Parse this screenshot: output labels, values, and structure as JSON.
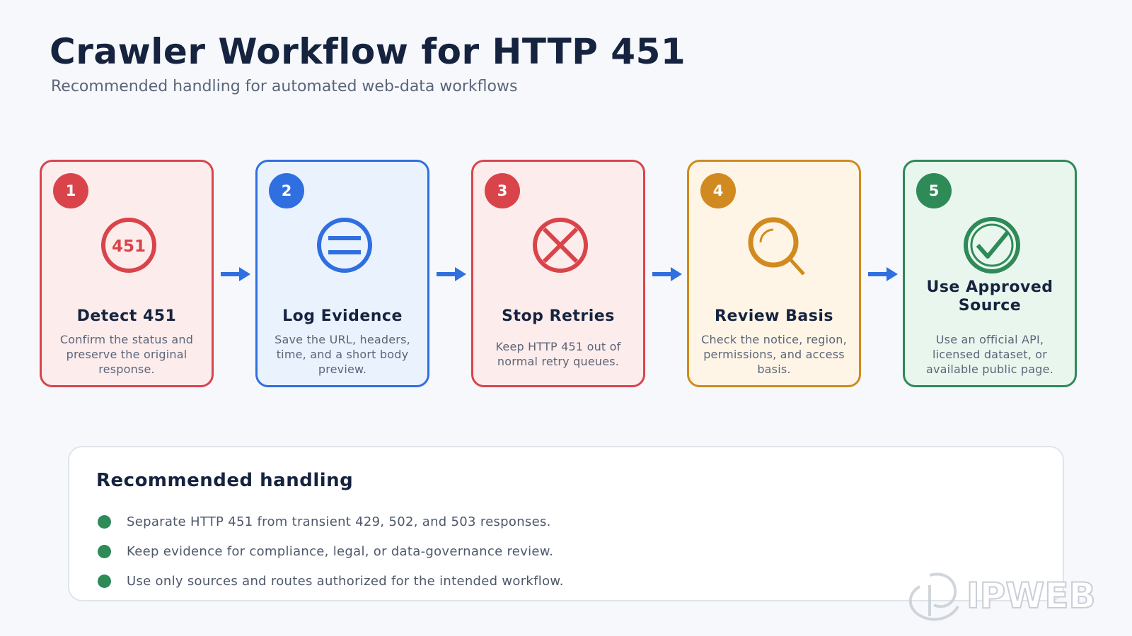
{
  "header": {
    "title": "Crawler Workflow for HTTP 451",
    "subtitle": "Recommended handling for automated web-data workflows"
  },
  "steps": [
    {
      "number": "1",
      "icon": "451-status-icon",
      "icon_text": "451",
      "title": "Detect 451",
      "description": "Confirm the status and preserve the original response.",
      "color": "#d9444b",
      "bg": "#fdecec"
    },
    {
      "number": "2",
      "icon": "log-list-icon",
      "title": "Log Evidence",
      "description": "Save the URL, headers, time, and a short body preview.",
      "color": "#2f6fe0",
      "bg": "#eaf2fe"
    },
    {
      "number": "3",
      "icon": "stop-x-icon",
      "title": "Stop Retries",
      "description": "Keep HTTP 451 out of normal retry queues.",
      "color": "#d9444b",
      "bg": "#fdecec"
    },
    {
      "number": "4",
      "icon": "magnifier-icon",
      "title": "Review Basis",
      "description": "Check the notice, region, permissions, and access basis.",
      "color": "#d08a1f",
      "bg": "#fef5e6"
    },
    {
      "number": "5",
      "icon": "check-circle-icon",
      "title": "Use Approved Source",
      "description": "Use an official API, licensed dataset, or available public page.",
      "color": "#2e8a57",
      "bg": "#e9f6ee"
    }
  ],
  "handling": {
    "title": "Recommended handling",
    "items": [
      "Separate HTTP 451 from transient 429, 502, and 503 responses.",
      "Keep evidence for compliance, legal, or data-governance review.",
      "Use only sources and routes authorized for the intended workflow."
    ]
  },
  "watermark": {
    "text": "IPWEB"
  },
  "colors": {
    "arrow": "#2f6fe0",
    "bullet": "#2e8a57",
    "title": "#15233f"
  }
}
